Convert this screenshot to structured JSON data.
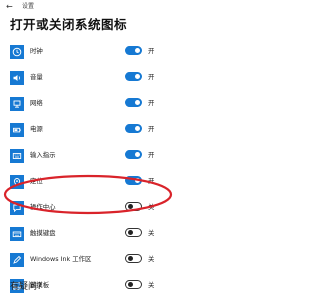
{
  "window": {
    "back_glyph": "←",
    "title": "设置"
  },
  "heading": "打开或关闭系统图标",
  "rows": [
    {
      "icon": "clock-icon",
      "label": "时钟",
      "state": "开",
      "on": true
    },
    {
      "icon": "volume-icon",
      "label": "音量",
      "state": "开",
      "on": true
    },
    {
      "icon": "network-icon",
      "label": "网络",
      "state": "开",
      "on": true
    },
    {
      "icon": "power-icon",
      "label": "电源",
      "state": "开",
      "on": true
    },
    {
      "icon": "input-indicator-icon",
      "label": "输入指示",
      "state": "开",
      "on": true
    },
    {
      "icon": "location-icon",
      "label": "定位",
      "state": "开",
      "on": true
    },
    {
      "icon": "action-center-icon",
      "label": "操作中心",
      "state": "关",
      "on": false
    },
    {
      "icon": "touch-keyboard-icon",
      "label": "触摸键盘",
      "state": "关",
      "on": false
    },
    {
      "icon": "windows-ink-icon",
      "label": "Windows Ink 工作区",
      "state": "关",
      "on": false
    },
    {
      "icon": "touchpad-icon",
      "label": "触摸板",
      "state": "关",
      "on": false
    }
  ],
  "footer": "有疑问?",
  "colors": {
    "accent": "#1679d3",
    "annotation": "#d9232a"
  }
}
